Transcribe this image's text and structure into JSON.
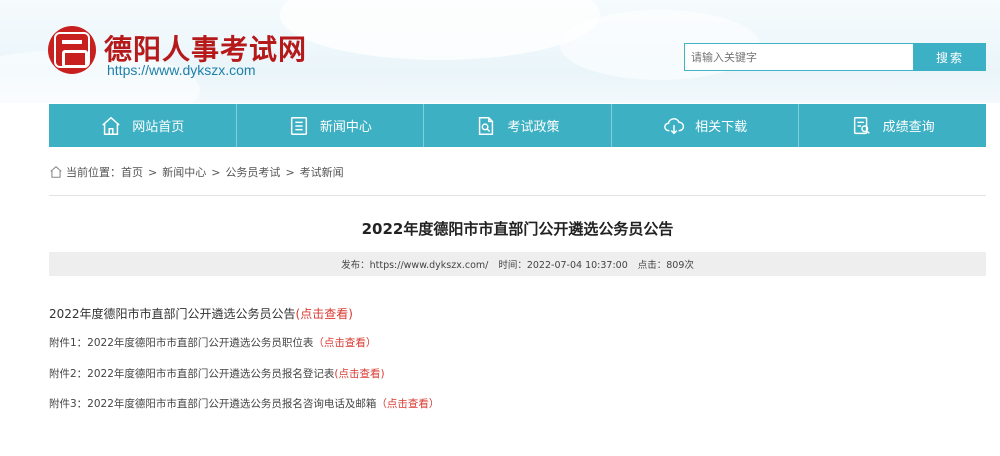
{
  "header": {
    "site_name": "德阳人事考试网",
    "site_url": "https://www.dykszx.com",
    "logo_icon": "seal-logo-icon",
    "brand_color": "#b5191a"
  },
  "search": {
    "placeholder": "请输入关键字",
    "button_label": "搜索"
  },
  "nav": {
    "color": "#3db0c3",
    "items": [
      {
        "label": "网站首页",
        "icon": "home-icon"
      },
      {
        "label": "新闻中心",
        "icon": "news-icon"
      },
      {
        "label": "考试政策",
        "icon": "policy-icon"
      },
      {
        "label": "相关下载",
        "icon": "cloud-download-icon"
      },
      {
        "label": "成绩查询",
        "icon": "score-search-icon"
      }
    ]
  },
  "breadcrumb": {
    "prefix": "当前位置：",
    "items": [
      "首页",
      "新闻中心",
      "公务员考试",
      "考试新闻"
    ]
  },
  "article": {
    "title": "2022年度德阳市市直部门公开遴选公务员公告",
    "meta": {
      "publisher": "发布：https://www.dykszx.com/",
      "time": "时间：2022-07-04 10:37:00",
      "clicks": "点击：809次"
    },
    "main_line": {
      "text": "2022年度德阳市市直部门公开遴选公务员公告",
      "link": "(点击查看)"
    },
    "attachments": [
      {
        "text": "附件1：2022年度德阳市市直部门公开遴选公务员职位表",
        "link": "（点击查看）"
      },
      {
        "text": "附件2：2022年度德阳市市直部门公开遴选公务员报名登记表",
        "link": "(点击查看)"
      },
      {
        "text": "附件3：2022年度德阳市市直部门公开遴选公务员报名咨询电话及邮箱",
        "link": "（点击查看）"
      }
    ]
  },
  "colors": {
    "link": "#d93a32",
    "accent": "#3cb0c4"
  }
}
